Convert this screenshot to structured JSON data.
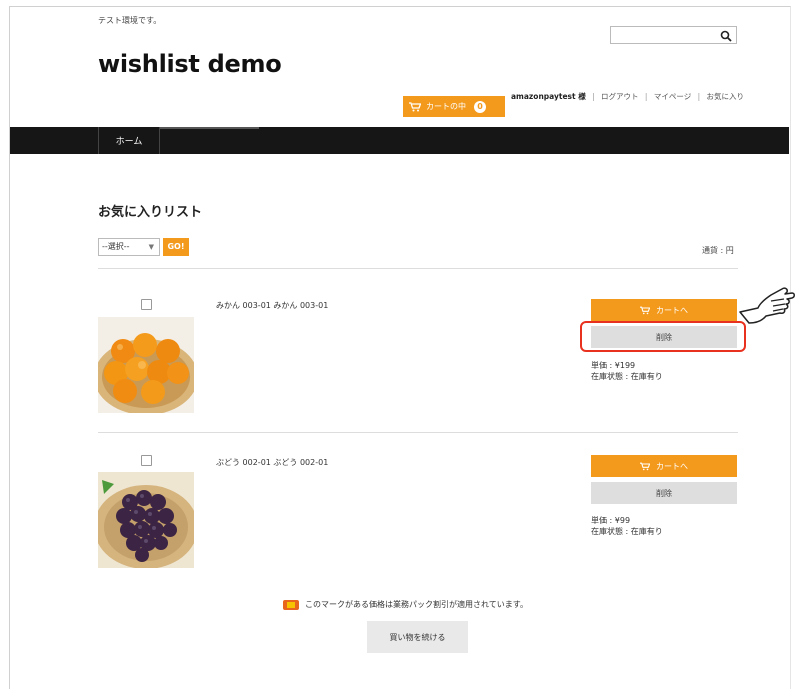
{
  "header": {
    "notice": "テスト環境です。",
    "site_title": "wishlist demo",
    "search_placeholder": "",
    "cart_button": "カートの中",
    "cart_count": "0",
    "user_name": "amazonpaytest 様",
    "links": [
      "ログアウト",
      "マイページ",
      "お気に入り"
    ]
  },
  "nav": {
    "tabs": [
      "ホーム"
    ]
  },
  "main": {
    "title": "お気に入りリスト",
    "bulk_select": "--選択--",
    "go_button": "GO!",
    "currency": "通貨 : 円",
    "items": [
      {
        "name": "みかん 003-01 みかん 003-01",
        "cart_button": "カートへ",
        "delete_button": "削除",
        "price": "単価 : ¥199",
        "stock": "在庫状態 : 在庫有り"
      },
      {
        "name": "ぶどう 002-01 ぶどう 002-01",
        "cart_button": "カートへ",
        "delete_button": "削除",
        "price": "単価 : ¥99",
        "stock": "在庫状態 : 在庫有り"
      }
    ],
    "legend_text": "このマークがある価格は業務パック割引が適用されています。",
    "continue_button": "買い物を続ける"
  },
  "colors": {
    "accent": "#f39a1d",
    "nav_bg": "#161616",
    "highlight": "#e8321f"
  }
}
